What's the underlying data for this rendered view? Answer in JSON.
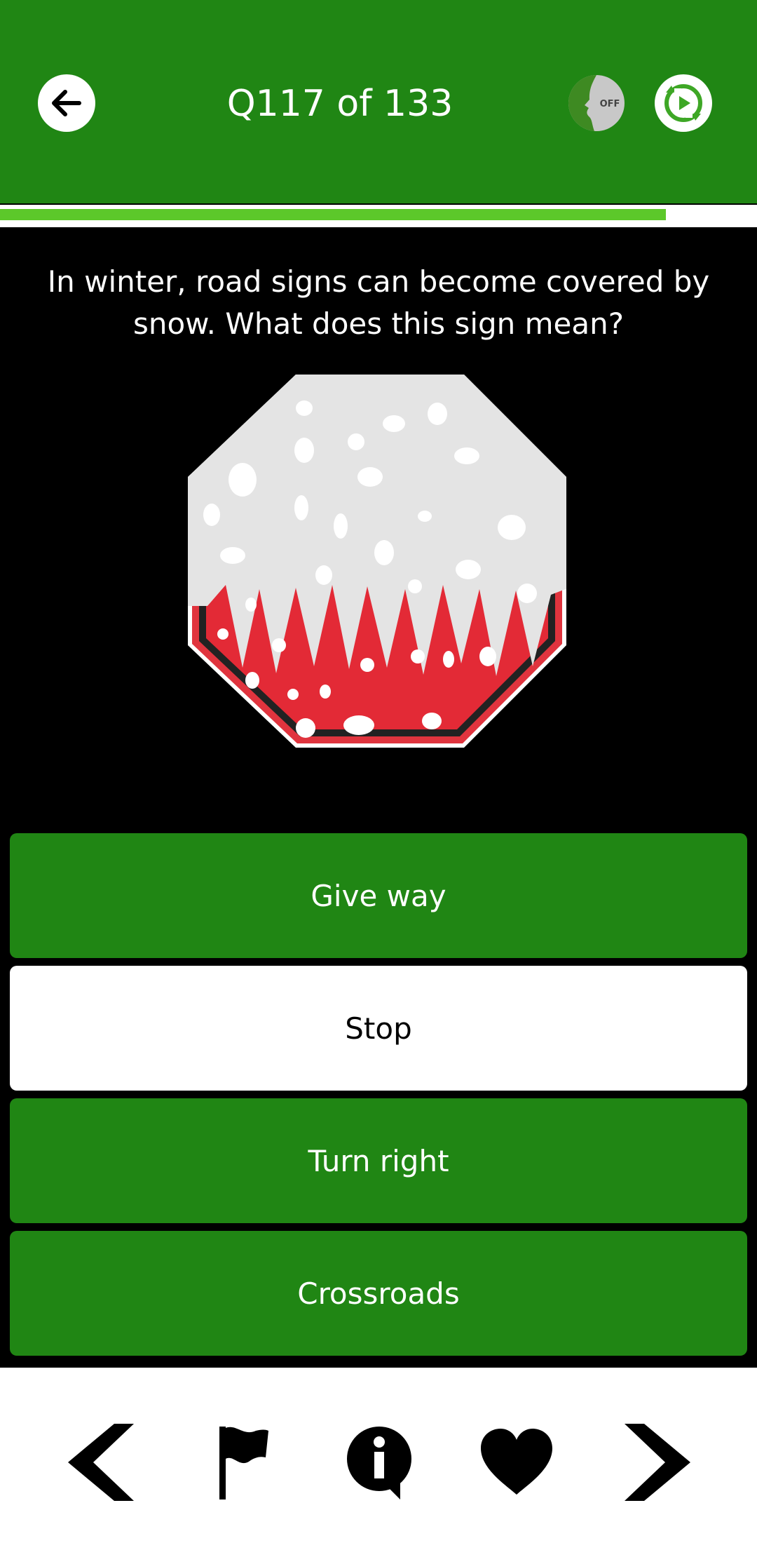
{
  "header": {
    "title": "Q117 of 133",
    "back_icon": "arrow-left-icon",
    "voice_icon": "voice-off-icon",
    "voice_badge": "OFF",
    "replay_icon": "replay-icon",
    "background_color": "#208614"
  },
  "progress": {
    "current": 117,
    "total": 133,
    "fraction": 0.88,
    "fill_color": "#5cc82a"
  },
  "question": {
    "text": "In winter, road signs can become covered by snow. What does this sign mean?"
  },
  "sign_image": {
    "icon": "snow-covered-stop-sign-icon"
  },
  "answers": [
    {
      "label": "Give way",
      "selected": false
    },
    {
      "label": "Stop",
      "selected": true
    },
    {
      "label": "Turn right",
      "selected": false
    },
    {
      "label": "Crossroads",
      "selected": false
    }
  ],
  "bottom_nav": {
    "items": [
      "chevron-left-icon",
      "flag-icon",
      "info-icon",
      "heart-icon",
      "chevron-right-icon"
    ]
  }
}
